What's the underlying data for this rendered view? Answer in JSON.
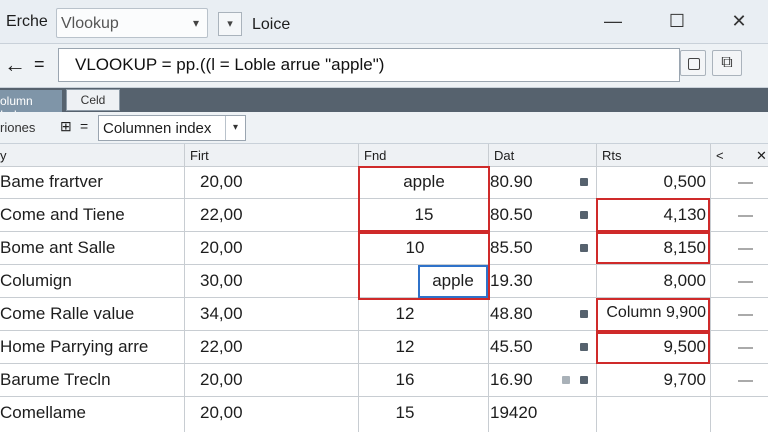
{
  "window": {
    "app_label": "Erche",
    "name_box": "Vlookup",
    "fn_dropdown": "▾",
    "fn_label": "Loice",
    "minimize": "—",
    "restore": "☐",
    "close": "✕"
  },
  "formula_bar": {
    "back": "←",
    "equals": "=",
    "formula": "VLOOKUP   =  pp.((l =  Loble arrue   \"apple\")",
    "btn_b": "⧉"
  },
  "tabs": {
    "active": "olumn Index",
    "cell": "Celd"
  },
  "options": {
    "label": "riones",
    "icon": "⊞",
    "eq": "=",
    "column_select": "Columnen index",
    "caret": "▾"
  },
  "grid": {
    "headers": [
      "y",
      "Firt",
      "Fnd",
      "Dat",
      "Rts",
      "<",
      "✕"
    ],
    "rows": [
      {
        "c0": "Bame frartver",
        "c1": "20,00",
        "c2": "apple",
        "c3": "80.90",
        "c4": "0,500"
      },
      {
        "c0": "Come and Tiene",
        "c1": "22,00",
        "c2": "15",
        "c3": "80.50",
        "c4": "4,130"
      },
      {
        "c0": "Bome ant Salle",
        "c1": "20,00",
        "c2": "10",
        "c3": "85.50",
        "c4": "8,150"
      },
      {
        "c0": "Columign",
        "c1": "30,00",
        "c2": "apple",
        "c3": "19.30",
        "c4": "8,000"
      },
      {
        "c0": "Come Ralle value",
        "c1": "34,00",
        "c2": "12",
        "c3": "48.80",
        "c4": "Column  9,900"
      },
      {
        "c0": "Home Parrying arre",
        "c1": "22,00",
        "c2": "12",
        "c3": "45.50",
        "c4": "9,500"
      },
      {
        "c0": "Barume Trecln",
        "c1": "20,00",
        "c2": "16",
        "c3": "16.90",
        "c4": "9,700"
      },
      {
        "c0": "Comellame",
        "c1": "20,00",
        "c2": "15",
        "c3": "19420",
        "c4": ""
      }
    ],
    "row_dash": "—"
  }
}
